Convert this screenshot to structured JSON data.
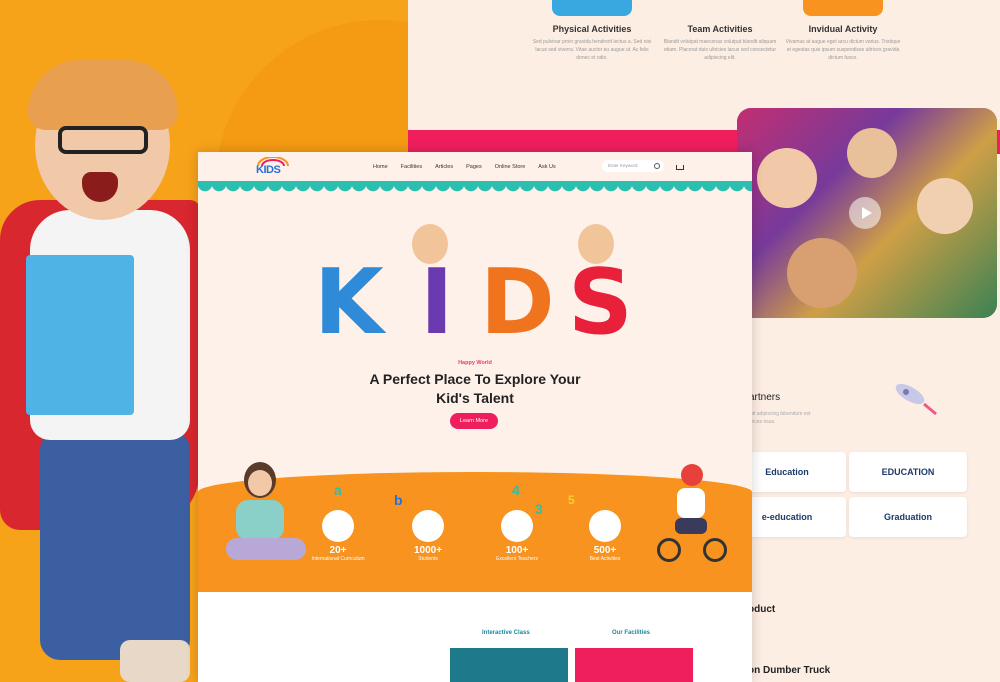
{
  "activities": [
    {
      "title": "Physical Activities",
      "text": "Sed pulvinar proin gravida hendrerit lectus a. Sed nisi lacus sed viverra. Vitae auctor eu augue ut. Ac felis donec et odio.",
      "color": "#3aa8e0"
    },
    {
      "title": "Team Activities",
      "text": "Blandit volutpat maecenas volutpat blandit aliquam etiam. Placerat duis ultricies lacus sed consectetur adipiscing elit.",
      "color": "#ffffff"
    },
    {
      "title": "Invidual Activity",
      "text": "Vivamus at augue eget arcu dictum varius. Tristique et egestas quis ipsum suspendisse ultrices gravida dictum fusce.",
      "color": "#f7931e"
    }
  ],
  "partners": {
    "title": "artners",
    "subtitle": "ipit adipiscing bibendum est ltrices risus.",
    "logos": [
      "Education",
      "EDUCATION",
      "e-education",
      "Graduation"
    ]
  },
  "products": [
    "oduct",
    "on Dumber Truck"
  ],
  "nav": {
    "logo": "KIDS",
    "menu": [
      "Home",
      "Facilities",
      "Articles",
      "Pages",
      "Online Store",
      "Ask Us"
    ],
    "search_placeholder": "Enter Keyword"
  },
  "hero": {
    "letters": [
      "K",
      "I",
      "D",
      "S"
    ],
    "tag": "Happy World",
    "headline_line1": "A Perfect Place To Explore Your",
    "headline_line2": "Kid's Talent",
    "cta": "Learn More"
  },
  "stats": [
    {
      "num": "20+",
      "label": "International Curriculum",
      "color": "#3aa8e0"
    },
    {
      "num": "1000+",
      "label": "Students",
      "color": "#2b6fd6"
    },
    {
      "num": "100+",
      "label": "Excellent Teachers",
      "color": "#f7931e"
    },
    {
      "num": "500+",
      "label": "Best Activities",
      "color": "#e8403a"
    }
  ],
  "floating_letters": [
    "a",
    "b",
    "4",
    "3",
    "5"
  ],
  "sections": {
    "interactive_class": "Interactive Class",
    "our_facilities": "Our Facilities"
  },
  "colors": {
    "accent_pink": "#ef1f5e",
    "accent_orange": "#f7931e",
    "teal": "#2bbfb0"
  }
}
